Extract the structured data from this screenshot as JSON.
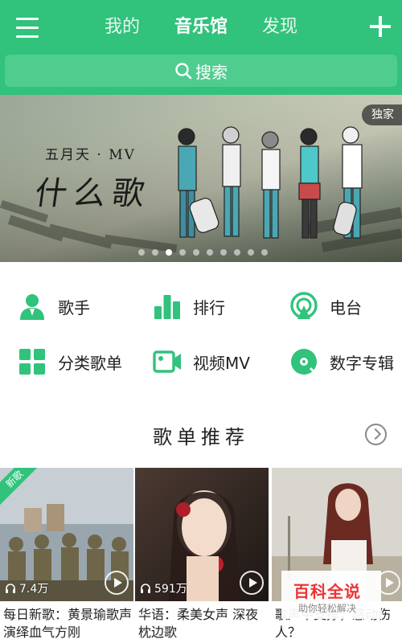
{
  "header": {
    "tabs": [
      "我的",
      "音乐馆",
      "发现"
    ],
    "active_tab": 1,
    "search_placeholder": "搜索"
  },
  "banner": {
    "badge": "独家",
    "caption_line1": "五月天 · MV",
    "caption_line2": "什么歌",
    "dots_total": 10,
    "active_dot": 2
  },
  "grid": [
    {
      "label": "歌手",
      "icon": "singer-icon"
    },
    {
      "label": "排行",
      "icon": "ranking-icon"
    },
    {
      "label": "电台",
      "icon": "radio-icon"
    },
    {
      "label": "分类歌单",
      "icon": "category-icon"
    },
    {
      "label": "视频MV",
      "icon": "video-icon"
    },
    {
      "label": "数字专辑",
      "icon": "album-icon"
    }
  ],
  "section": {
    "title": "歌单推荐"
  },
  "cards": [
    {
      "title": "每日新歌：黄景瑜歌声演绎血气方刚",
      "plays": "7.4万",
      "ribbon": "新歌"
    },
    {
      "title": "华语：柔美女声 深夜枕边歌",
      "plays": "591万"
    },
    {
      "title": "歌声中支撑，感动伤人？"
    }
  ],
  "watermark": {
    "main": "百科全说",
    "sub": "助你轻松解决"
  },
  "colors": {
    "brand_green": "#31c27c",
    "search_green": "#4fcd8f"
  }
}
